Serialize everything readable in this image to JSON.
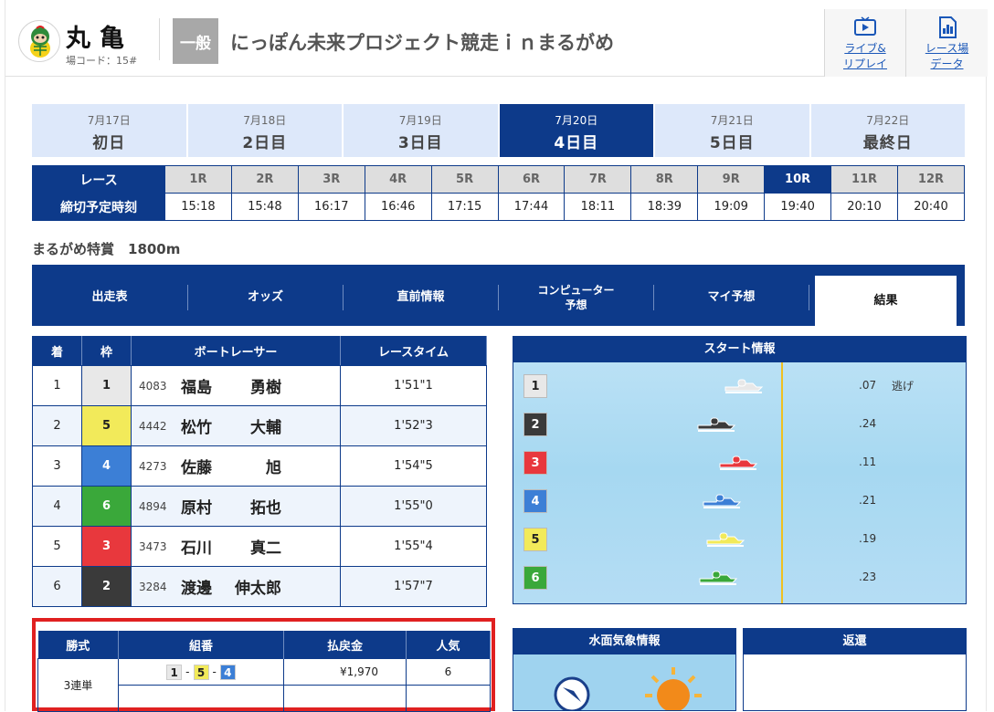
{
  "header": {
    "venue_name": "丸亀",
    "venue_code": "場コード：15#",
    "grade": "一般",
    "race_title": "にっぽん未来プロジェクト競走ｉｎまるがめ",
    "live_replay": [
      "ライブ&",
      "リプレイ"
    ],
    "venue_data": [
      "レース場",
      "データ"
    ]
  },
  "days": [
    {
      "date": "7月17日",
      "label": "初日",
      "active": false
    },
    {
      "date": "7月18日",
      "label": "2日目",
      "active": false
    },
    {
      "date": "7月19日",
      "label": "3日目",
      "active": false
    },
    {
      "date": "7月20日",
      "label": "4日目",
      "active": true
    },
    {
      "date": "7月21日",
      "label": "5日目",
      "active": false
    },
    {
      "date": "7月22日",
      "label": "最終日",
      "active": false
    }
  ],
  "races": {
    "row_label": "レース",
    "time_label": "締切予定時刻",
    "numbers": [
      "1R",
      "2R",
      "3R",
      "4R",
      "5R",
      "6R",
      "7R",
      "8R",
      "9R",
      "10R",
      "11R",
      "12R"
    ],
    "times": [
      "15:18",
      "15:48",
      "16:17",
      "16:46",
      "17:15",
      "17:44",
      "18:11",
      "18:39",
      "19:09",
      "19:40",
      "20:10",
      "20:40"
    ],
    "active_index": 9
  },
  "course": "まるがめ特賞　1800m",
  "nav": [
    {
      "label": "出走表"
    },
    {
      "label": "オッズ"
    },
    {
      "label": "直前情報"
    },
    {
      "label": "コンピューター\n予想"
    },
    {
      "label": "マイ予想"
    },
    {
      "label": "結果"
    }
  ],
  "result": {
    "headers": [
      "着",
      "枠",
      "ボートレーサー",
      "レースタイム"
    ],
    "rows": [
      {
        "rank": "1",
        "frame": "1",
        "reg": "4083",
        "last": "福島",
        "first": "勇樹",
        "time": "1'51\"1"
      },
      {
        "rank": "2",
        "frame": "5",
        "reg": "4442",
        "last": "松竹",
        "first": "大輔",
        "time": "1'52\"3"
      },
      {
        "rank": "3",
        "frame": "4",
        "reg": "4273",
        "last": "佐藤",
        "first": "旭",
        "time": "1'54\"5"
      },
      {
        "rank": "4",
        "frame": "6",
        "reg": "4894",
        "last": "原村",
        "first": "拓也",
        "time": "1'55\"0"
      },
      {
        "rank": "5",
        "frame": "3",
        "reg": "3473",
        "last": "石川",
        "first": "真二",
        "time": "1'55\"4"
      },
      {
        "rank": "6",
        "frame": "2",
        "reg": "3284",
        "last": "渡邊",
        "first": "伸太郎",
        "time": "1'57\"7"
      }
    ]
  },
  "start_info": {
    "title": "スタート情報",
    "rows": [
      {
        "course": "1",
        "st": ".07",
        "note": "逃げ"
      },
      {
        "course": "2",
        "st": ".24",
        "note": ""
      },
      {
        "course": "3",
        "st": ".11",
        "note": ""
      },
      {
        "course": "4",
        "st": ".21",
        "note": ""
      },
      {
        "course": "5",
        "st": ".19",
        "note": ""
      },
      {
        "course": "6",
        "st": ".23",
        "note": ""
      }
    ]
  },
  "payout": {
    "headers": [
      "勝式",
      "組番",
      "払戻金",
      "人気"
    ],
    "bet_type": "3連単",
    "combo": [
      "1",
      "5",
      "4"
    ],
    "amount": "¥1,970",
    "popularity": "6"
  },
  "weather_title": "水面気象情報",
  "refund_title": "返還",
  "frame_colors": {
    "1": {
      "bg": "#e8e8e8",
      "fg": "#222222"
    },
    "2": {
      "bg": "#3a3a3a",
      "fg": "#ffffff"
    },
    "3": {
      "bg": "#e8383d",
      "fg": "#ffffff"
    },
    "4": {
      "bg": "#3c7fd6",
      "fg": "#ffffff"
    },
    "5": {
      "bg": "#f2ea5a",
      "fg": "#222222"
    },
    "6": {
      "bg": "#3aa83a",
      "fg": "#ffffff"
    }
  }
}
